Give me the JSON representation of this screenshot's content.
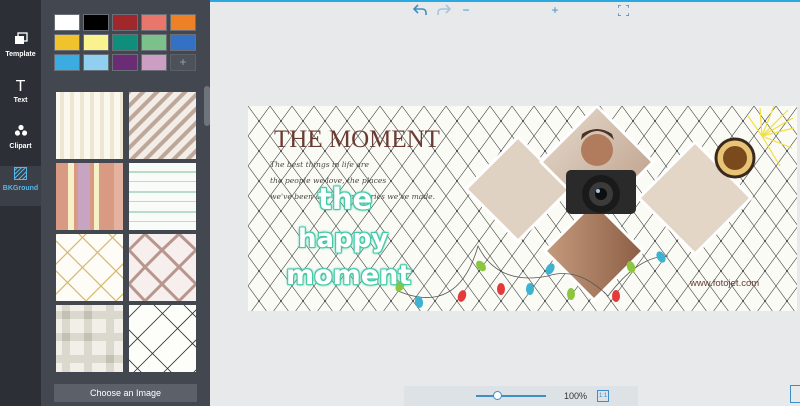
{
  "rail": {
    "items": [
      {
        "label": "Template",
        "icon": "template-icon"
      },
      {
        "label": "Text",
        "icon": "text-icon"
      },
      {
        "label": "Clipart",
        "icon": "clipart-icon"
      },
      {
        "label": "BKGround",
        "icon": "background-icon"
      }
    ],
    "active": "BKGround"
  },
  "panel": {
    "swatches": [
      "#ffffff",
      "#000000",
      "#a0282d",
      "#e8766a",
      "#ee8026",
      "#f0c22b",
      "#faf28f",
      "#0f8e7b",
      "#7cc08a",
      "#3470c4",
      "#3aace2",
      "#8fd0f0",
      "#6a2c74",
      "#cc9ec4"
    ],
    "add_label": "+",
    "choose_image_label": "Choose an Image"
  },
  "canvas": {
    "title": "THE MOMENT",
    "subtitle_lines": [
      "The best things in life are",
      "the people we love, the places",
      "we've been and the memories we've made."
    ],
    "word1": "the",
    "word2": "happy",
    "word3": "moment",
    "url": "www.fotojet.com"
  },
  "zoom": {
    "undo_icon": "undo-icon",
    "redo_icon": "redo-icon",
    "minus": "−",
    "plus": "+",
    "percent": "100%",
    "actual_size_label": "1:1"
  }
}
